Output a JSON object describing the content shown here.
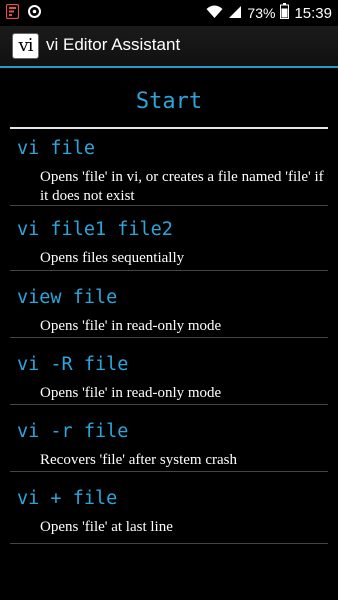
{
  "status_bar": {
    "left_icons": [
      "flipboard-notification-icon",
      "data-saver-icon"
    ],
    "battery_percent": "73%",
    "time": "15:39"
  },
  "action_bar": {
    "icon_text": "vi",
    "title": "vi Editor Assistant",
    "accent_color": "#2a98c9"
  },
  "section": {
    "title": "Start"
  },
  "commands": [
    {
      "name": "vi file",
      "description": "Opens 'file' in vi, or creates a file named 'file' if it does not exist"
    },
    {
      "name": "vi file1 file2",
      "description": "Opens files sequentially"
    },
    {
      "name": "view file",
      "description": "Opens 'file' in read-only mode"
    },
    {
      "name": "vi -R file",
      "description": "Opens 'file' in read-only mode"
    },
    {
      "name": "vi -r file",
      "description": "Recovers 'file' after system crash"
    },
    {
      "name": "vi + file",
      "description": "Opens 'file' at last line"
    }
  ],
  "colors": {
    "command_text": "#2ba6dc",
    "description_text": "#ffffff",
    "background": "#000000"
  }
}
